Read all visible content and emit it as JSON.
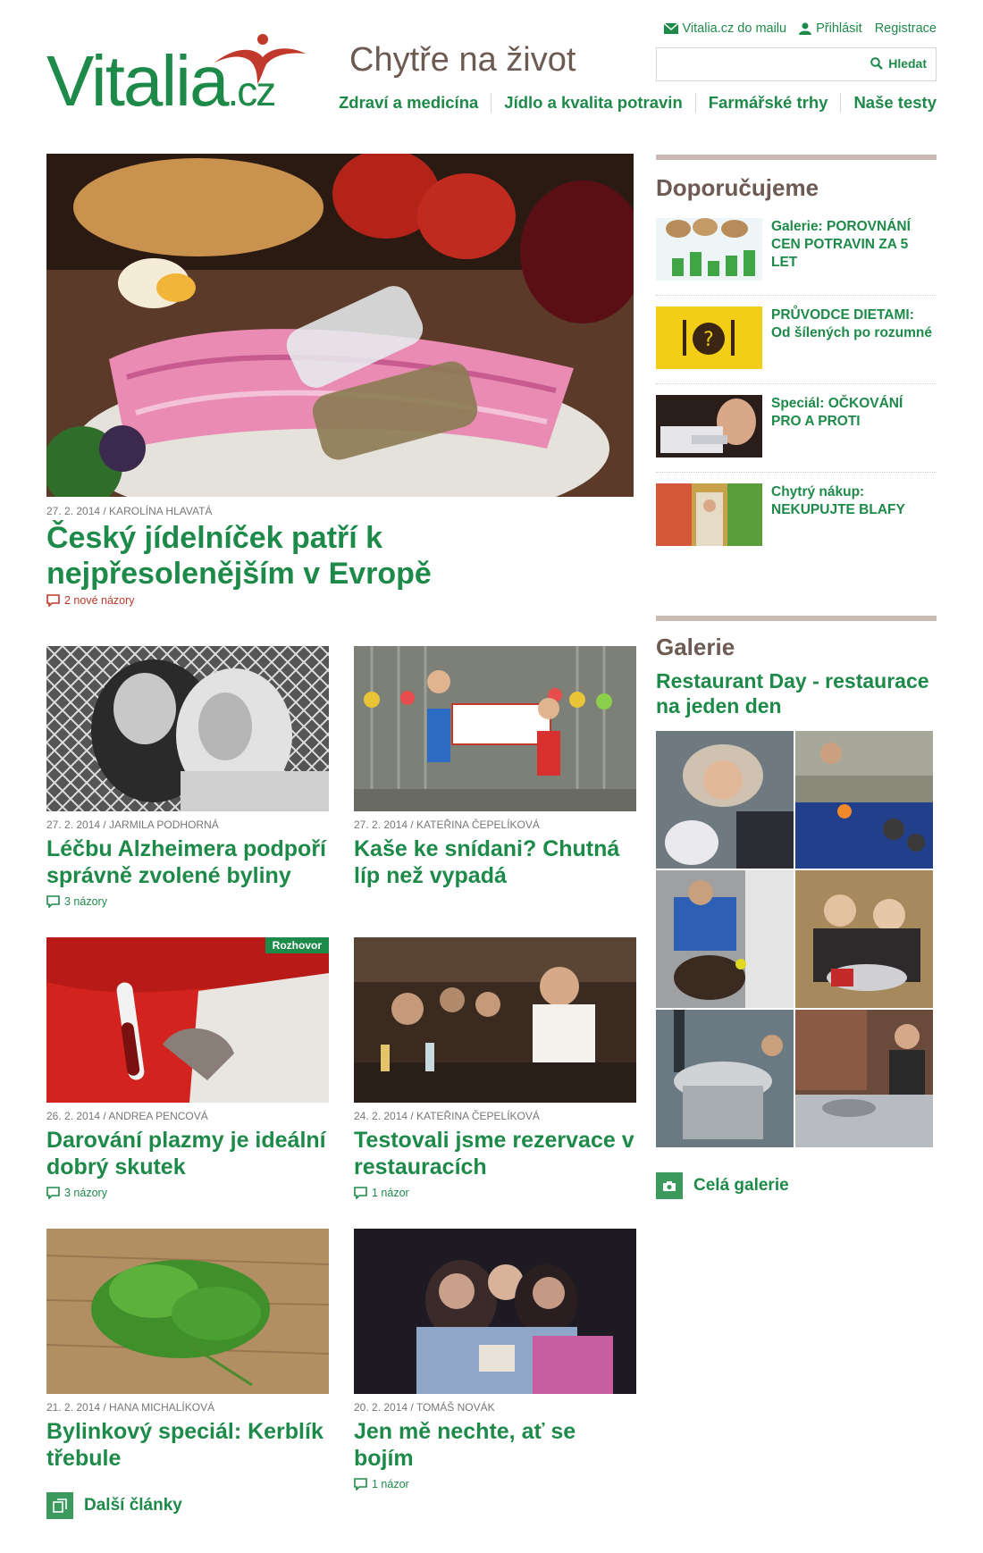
{
  "brand": {
    "logo_main": "Vitalia",
    "logo_suffix": ".cz",
    "tagline": "Chytře na život"
  },
  "toplinks": {
    "newsletter": "Vitalia.cz do mailu",
    "login": "Přihlásit",
    "register": "Registrace"
  },
  "search": {
    "placeholder": "",
    "button": "Hledat"
  },
  "nav": [
    "Zdraví a medicína",
    "Jídlo a kvalita potravin",
    "Farmářské trhy",
    "Naše testy"
  ],
  "hero": {
    "meta": "27. 2. 2014 / KAROLÍNA HLAVATÁ",
    "title": "Český jídelníček patří k nejpřesolenějším v Evropě",
    "comments": "2 nové názory"
  },
  "articles": [
    {
      "meta": "27. 2. 2014 / JARMILA PODHORNÁ",
      "title": "Léčbu Alzheimera podpoří správně zvolené byliny",
      "comments": "3 názory"
    },
    {
      "meta": "27. 2. 2014 / KATEŘINA ČEPELÍKOVÁ",
      "title": "Kaše ke snídani? Chutná líp než vypadá",
      "comments": ""
    },
    {
      "meta": "26. 2. 2014 / ANDREA PENCOVÁ",
      "title": "Darování plazmy je ideální dobrý skutek",
      "comments": "3 názory",
      "badge": "Rozhovor"
    },
    {
      "meta": "24. 2. 2014 / KATEŘINA ČEPELÍKOVÁ",
      "title": "Testovali jsme rezervace v restauracích",
      "comments": "1 názor"
    },
    {
      "meta": "21. 2. 2014 / HANA MICHALÍKOVÁ",
      "title": "Bylinkový speciál: Kerblík třebule",
      "comments": ""
    },
    {
      "meta": "20. 2. 2014 / TOMÁŠ NOVÁK",
      "title": "Jen mě nechte, ať se bojím",
      "comments": "1 názor"
    }
  ],
  "more_articles": "Další články",
  "sidebar": {
    "recommend_heading": "Doporučujeme",
    "recommend": [
      "Galerie: POROVNÁNÍ CEN POTRAVIN ZA 5 LET",
      "PRŮVODCE DIETAMI: Od šílených po rozumné",
      "Speciál: OČKOVÁNÍ PRO A PROTI",
      "Chytrý nákup: NEKUPUJTE BLAFY"
    ],
    "gallery_heading": "Galerie",
    "gallery_title": "Restaurant Day - restaurace na jeden den",
    "gallery_link": "Celá galerie"
  },
  "colors": {
    "green": "#1e8a4a",
    "brown": "#6d5a52",
    "red": "#c0392b"
  },
  "icons": [
    "mail-icon",
    "user-icon",
    "search-icon",
    "comment-icon",
    "articles-icon",
    "camera-icon"
  ]
}
